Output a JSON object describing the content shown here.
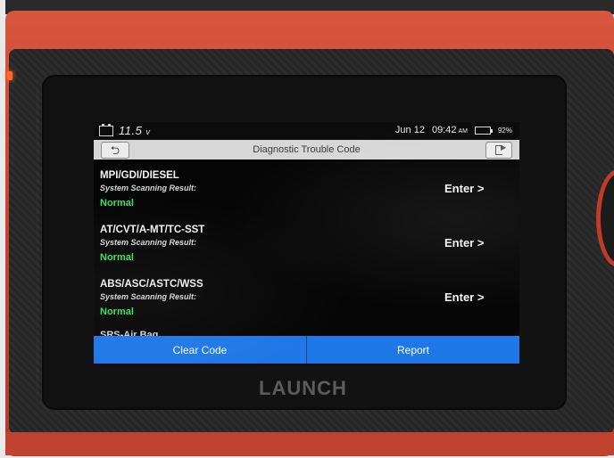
{
  "status_bar": {
    "voltage": "11.5",
    "voltage_unit": "v",
    "date": "Jun 12",
    "time": "09:42",
    "ampm": "AM",
    "battery_percent": "92%",
    "battery_level": 0.92,
    "battery_color": "#22d322"
  },
  "title_bar": {
    "title": "Diagnostic Trouble Code",
    "back_icon": "back-arrow-icon",
    "exit_icon": "exit-icon"
  },
  "systems": [
    {
      "name": "MPI/GDI/DIESEL",
      "label": "System Scanning Result:",
      "status": "Normal",
      "action": "Enter >"
    },
    {
      "name": "AT/CVT/A-MT/TC-SST",
      "label": "System Scanning Result:",
      "status": "Normal",
      "action": "Enter >"
    },
    {
      "name": "ABS/ASC/ASTC/WSS",
      "label": "System Scanning Result:",
      "status": "Normal",
      "action": "Enter >"
    }
  ],
  "partial_system": "SRS-Air Bag",
  "actions": {
    "clear_code": "Clear Code",
    "report": "Report"
  },
  "brand": "LAUNCH",
  "colors": {
    "accent": "#1f78e8",
    "status_normal": "#38e060",
    "device_red": "#c84632"
  }
}
